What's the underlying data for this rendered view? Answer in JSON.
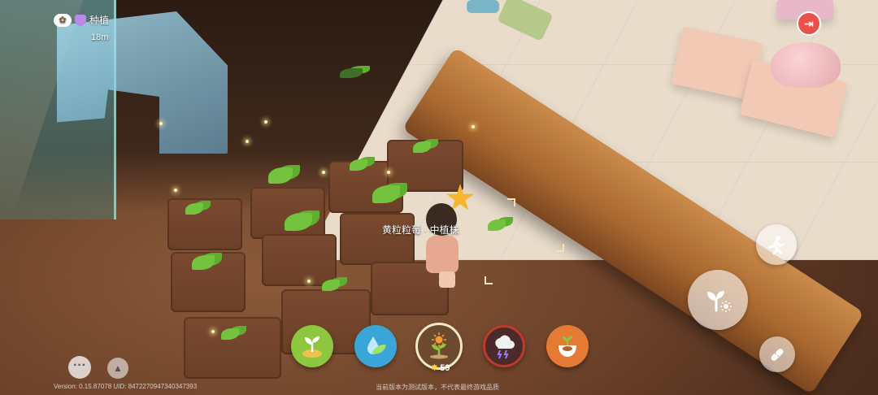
{
  "hud": {
    "location_label": "种植",
    "distance": "18m",
    "plant_label": "黄粒粒莓 · 中植株"
  },
  "actions": [
    {
      "name": "plant-seed",
      "icon": "sprout-soil-icon",
      "color": "#8dc63f"
    },
    {
      "name": "water",
      "icon": "water-drop-leaf-icon",
      "color": "#3aa6d8"
    },
    {
      "name": "sunlight",
      "icon": "sun-sprout-icon",
      "color": "#6b4a2f",
      "selected": true,
      "count": "59"
    },
    {
      "name": "weather",
      "icon": "storm-cloud-icon",
      "color": "#c0392b"
    },
    {
      "name": "harvest",
      "icon": "seed-bag-icon",
      "color": "#e57a35"
    }
  ],
  "side_buttons": [
    {
      "name": "run",
      "icon": "running-figure-icon"
    },
    {
      "name": "interact",
      "icon": "sprout-sun-icon"
    },
    {
      "name": "item",
      "icon": "bandage-icon"
    }
  ],
  "footer": {
    "version": "Version: 0.15.87078 UID: 8472270947340347393",
    "disclaimer": "当前版本为测试版本，不代表最终游戏品质"
  },
  "colors": {
    "exit": "#e9524a",
    "selected_ring": "#f5e7c4"
  }
}
